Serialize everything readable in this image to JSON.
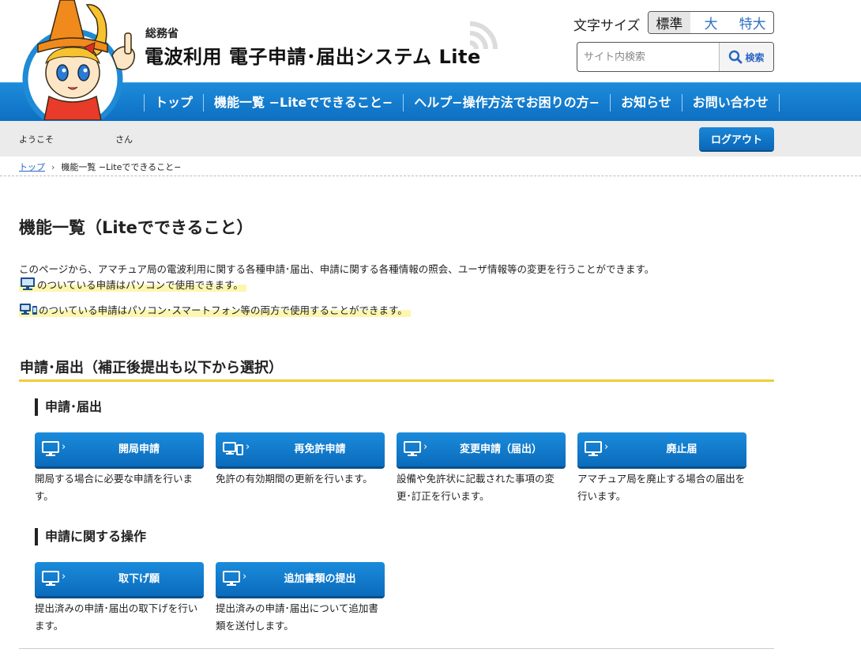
{
  "header": {
    "ministry": "総務省",
    "system_title": "電波利用 電子申請･届出システム Lite",
    "font_size_label": "文字サイズ",
    "font_sizes": [
      "標準",
      "大",
      "特大"
    ],
    "search_placeholder": "サイト内検索",
    "search_button": "検索"
  },
  "nav": {
    "items": [
      "トップ",
      "機能一覧 −Liteでできること−",
      "ヘルプ−操作方法でお困りの方−",
      "お知らせ",
      "お問い合わせ"
    ]
  },
  "welcome": {
    "greeting": "ようこそ",
    "suffix": "さん",
    "logout": "ログアウト"
  },
  "breadcrumb": {
    "home": "トップ",
    "separator": "›",
    "current": "機能一覧 −Liteでできること−"
  },
  "main": {
    "title": "機能一覧（Liteでできること）",
    "intro": "このページから、アマチュア局の電波利用に関する各種申請･届出、申請に関する各種情報の照会、ユーザ情報等の変更を行うことができます。",
    "note_pc": "のついている申請はパソコンで使用できます。",
    "note_both": "のついている申請はパソコン･スマートフォン等の両方で使用することができます。",
    "section_title": "申請･届出（補正後提出も以下から選択）",
    "groups": [
      {
        "title": "申請･届出",
        "functions": [
          {
            "label": "開局申請",
            "desc": "開局する場合に必要な申請を行います。",
            "icon": "pc-icon"
          },
          {
            "label": "再免許申請",
            "desc": "免許の有効期間の更新を行います。",
            "icon": "pc-smartphone-icon"
          },
          {
            "label": "変更申請（届出）",
            "desc": "設備や免許状に記載された事項の変更･訂正を行います。",
            "icon": "pc-icon"
          },
          {
            "label": "廃止届",
            "desc": "アマチュア局を廃止する場合の届出を行います。",
            "icon": "pc-icon"
          }
        ]
      },
      {
        "title": "申請に関する操作",
        "functions": [
          {
            "label": "取下げ願",
            "desc": "提出済みの申請･届出の取下げを行います。",
            "icon": "pc-icon"
          },
          {
            "label": "追加書類の提出",
            "desc": "提出済みの申請･届出について追加書類を送付します。",
            "icon": "pc-icon"
          }
        ]
      }
    ]
  },
  "colors": {
    "nav_blue": "#0d6fc3",
    "button_blue": "#1b8bdb",
    "section_underline": "#f2cb3c",
    "note_highlight": "#fdf6b0",
    "link": "#2b66c4"
  }
}
